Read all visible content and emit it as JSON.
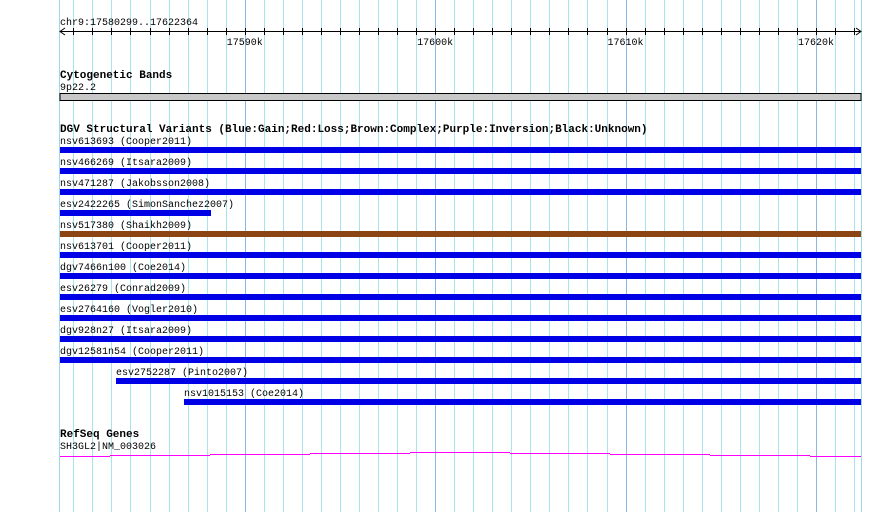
{
  "view": {
    "chrom": "chr9",
    "start": 17580299,
    "end": 17622364,
    "label": "chr9:17580299..17622364"
  },
  "ruler": {
    "tick_labels": [
      "17590k",
      "17600k",
      "17610k",
      "17620k"
    ],
    "major_ticks_bp": [
      17590000,
      17600000,
      17610000,
      17620000
    ],
    "minor_tick_interval_bp": 1000
  },
  "tracks": {
    "cyto": {
      "title": "Cytogenetic Bands",
      "band_label": "9p22.2",
      "band_color": "#c8c8c8"
    },
    "dgv": {
      "title": "DGV Structural Variants (Blue:Gain;Red:Loss;Brown:Complex;Purple:Inversion;Black:Unknown)",
      "colors": {
        "gain": "#0000e6",
        "complex": "#8b4513"
      },
      "features": [
        {
          "label": "nsv613693 (Cooper2011)",
          "type": "gain",
          "start": 17580299,
          "end": 17622364
        },
        {
          "label": "nsv466269 (Itsara2009)",
          "type": "gain",
          "start": 17580299,
          "end": 17622364
        },
        {
          "label": "nsv471287 (Jakobsson2008)",
          "type": "gain",
          "start": 17580299,
          "end": 17622364
        },
        {
          "label": "esv2422265 (SimonSanchez2007)",
          "type": "gain",
          "start": 17580299,
          "end": 17588230
        },
        {
          "label": "nsv517380 (Shaikh2009)",
          "type": "complex",
          "start": 17580299,
          "end": 17622364
        },
        {
          "label": "nsv613701 (Cooper2011)",
          "type": "gain",
          "start": 17580299,
          "end": 17622364
        },
        {
          "label": "dgv7466n100 (Coe2014)",
          "type": "gain",
          "start": 17580299,
          "end": 17622364
        },
        {
          "label": "esv26279 (Conrad2009)",
          "type": "gain",
          "start": 17580299,
          "end": 17622364
        },
        {
          "label": "esv2764160 (Vogler2010)",
          "type": "gain",
          "start": 17580299,
          "end": 17622364
        },
        {
          "label": "dgv928n27 (Itsara2009)",
          "type": "gain",
          "start": 17580299,
          "end": 17622364
        },
        {
          "label": "dgv12581n54 (Cooper2011)",
          "type": "gain",
          "start": 17580299,
          "end": 17622364
        },
        {
          "label": "esv2752287 (Pinto2007)",
          "type": "gain",
          "start": 17583240,
          "end": 17622364
        },
        {
          "label": "nsv1015153 (Coe2014)",
          "type": "gain",
          "start": 17586810,
          "end": 17622364
        }
      ]
    },
    "refseq": {
      "title": "RefSeq Genes",
      "gene_label": "SH3GL2|NM_003026",
      "color": "#ff00ff"
    }
  }
}
